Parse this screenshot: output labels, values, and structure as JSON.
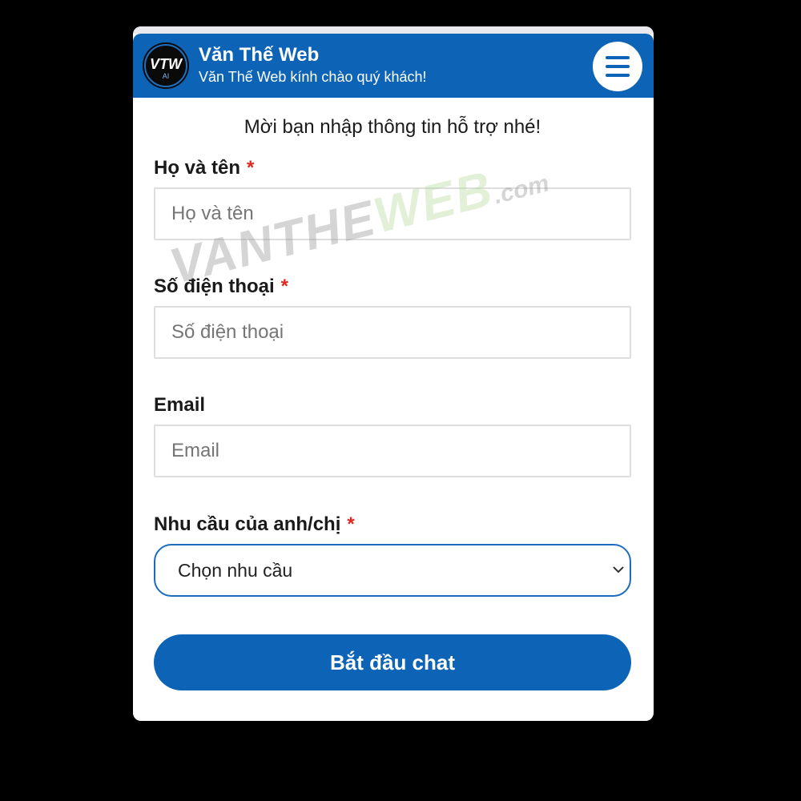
{
  "header": {
    "title": "Văn Thế Web",
    "subtitle": "Văn Thế Web kính chào quý khách!",
    "logo_text": "VTW",
    "logo_subtext": "AI",
    "menu_icon": "hamburger-menu-icon"
  },
  "form": {
    "intro": "Mời bạn nhập thông tin hỗ trợ nhé!",
    "required_mark": "*",
    "name": {
      "label": "Họ và tên",
      "placeholder": "Họ và tên",
      "value": ""
    },
    "phone": {
      "label": "Số điện thoại",
      "placeholder": "Số điện thoại",
      "value": ""
    },
    "email": {
      "label": "Email",
      "placeholder": "Email",
      "value": ""
    },
    "need": {
      "label": "Nhu cầu của anh/chị",
      "selected": "Chọn nhu cầu"
    },
    "submit_label": "Bắt đầu chat"
  },
  "watermark": {
    "part1": "VANTHE",
    "part2": "WEB",
    "part3": ".com"
  },
  "colors": {
    "brand_blue": "#0d64b6",
    "required_red": "#e0261f",
    "page_background": "#000000"
  }
}
